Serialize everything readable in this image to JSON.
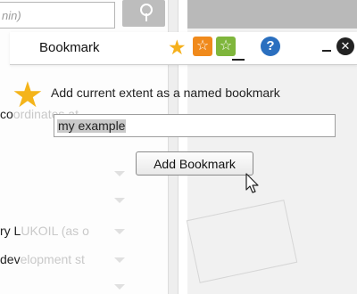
{
  "background": {
    "search_placeholder": "nin)",
    "sidebar_rows": [
      {
        "visible": "co",
        "faded": "ordinates at"
      },
      {
        "visible": "ry L",
        "faded": "UKOIL (as o"
      },
      {
        "visible": "dev",
        "faded": "elopment st"
      }
    ]
  },
  "bookmark_widget": {
    "title": "Bookmark",
    "toolbar": {
      "star_icon": "star-icon",
      "help_label": "?",
      "close_label": "✕"
    },
    "instruction": "Add current extent as a named bookmark",
    "input_value": "my example",
    "add_button_label": "Add Bookmark"
  },
  "colors": {
    "star": "#f4b41a",
    "orange_tool": "#f08a1c",
    "green_tool": "#7fb63c",
    "help_blue": "#2a6fbf"
  }
}
